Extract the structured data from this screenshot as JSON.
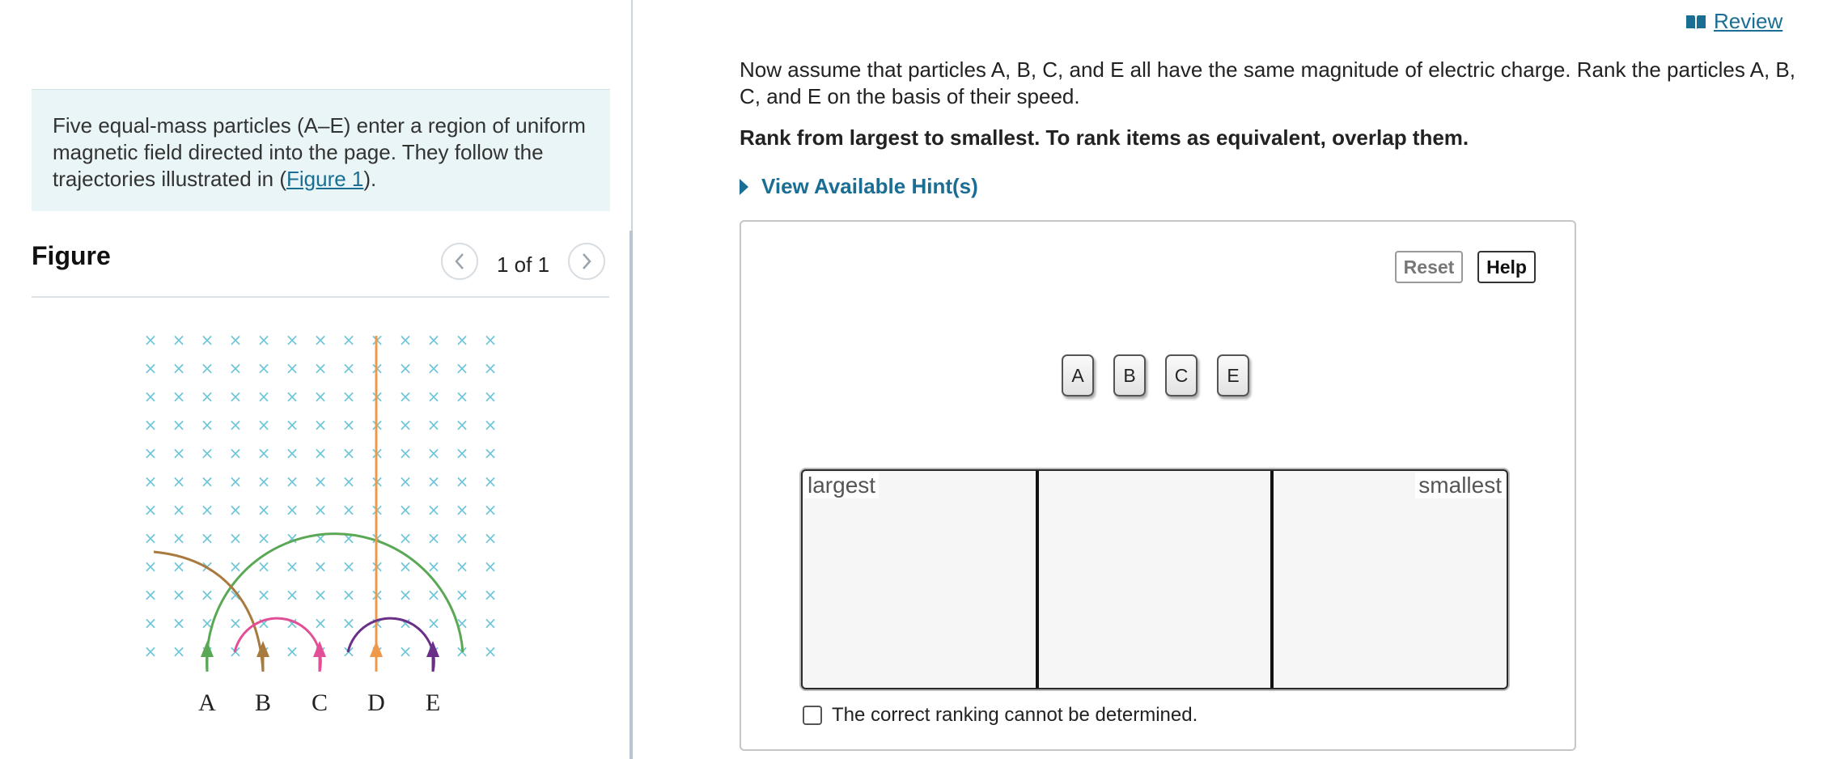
{
  "intro": {
    "text_before": "Five equal-mass particles (A–E) enter a region of uniform magnetic field directed into the page. They follow the trajectories illustrated in  (",
    "link": "Figure 1",
    "text_after": ")."
  },
  "figure": {
    "title": "Figure",
    "pager": "1 of 1",
    "field_symbol": "×",
    "particle_labels": [
      "A",
      "B",
      "C",
      "D",
      "E"
    ],
    "colors": {
      "field": "#6ec6d8",
      "A": "#5aa855",
      "B": "#a87a3e",
      "C": "#e24f96",
      "D": "#f0984a",
      "E": "#6a2f86"
    }
  },
  "header": {
    "review_label": " Review",
    "review_icon": "book-icon"
  },
  "question": {
    "text": "Now assume that particles A, B, C, and E all have the same magnitude of electric charge. Rank the particles A, B, C, and E on the basis of their speed.",
    "instruction": "Rank from largest to smallest. To rank items as equivalent, overlap them.",
    "hint_label": "View Available Hint(s)"
  },
  "ranking": {
    "reset_label": "Reset",
    "help_label": "Help",
    "items": [
      "A",
      "B",
      "C",
      "E"
    ],
    "largest_label": "largest",
    "smallest_label": "smallest",
    "cannot_determine_label": "The correct ranking cannot be determined.",
    "cannot_determine_checked": false
  },
  "colors": {
    "accent": "#1a6e93",
    "intro_bg": "#e9f5f6"
  }
}
